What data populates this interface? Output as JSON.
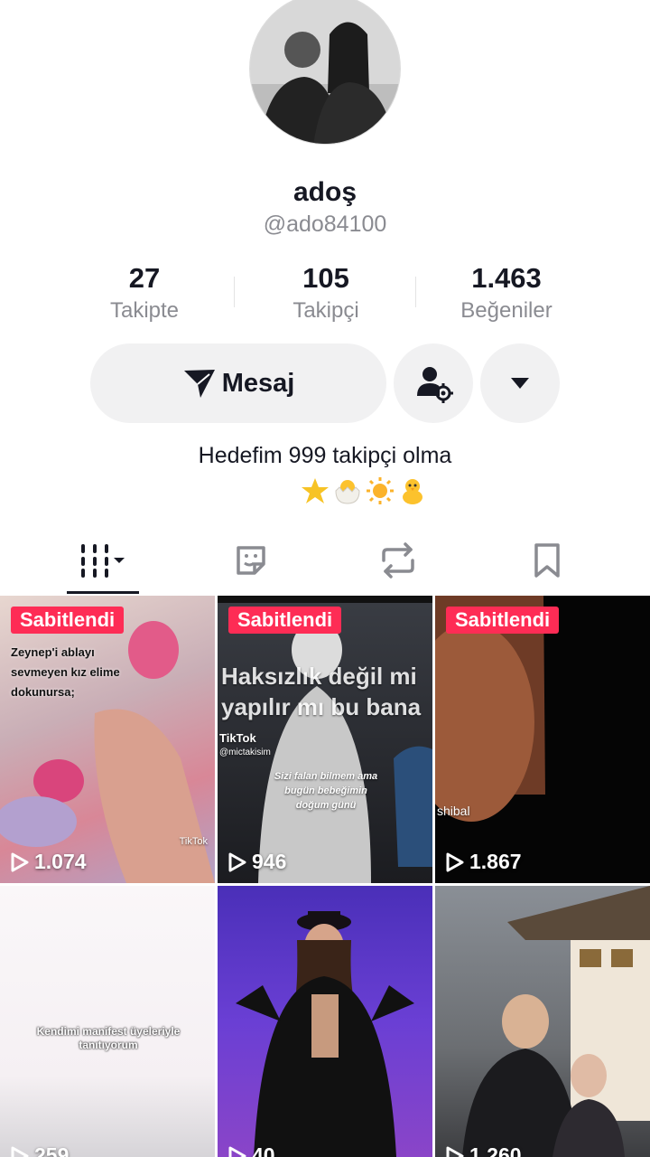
{
  "profile": {
    "display_name": "adoş",
    "username": "@ado84100",
    "bio": "Hedefim 999 takipçi olma",
    "bio_emojis": [
      "star-emoji",
      "hatching-chick-emoji",
      "sun-emoji",
      "baby-chick-emoji"
    ]
  },
  "stats": [
    {
      "value": "27",
      "label": "Takipte"
    },
    {
      "value": "105",
      "label": "Takipçi"
    },
    {
      "value": "1.463",
      "label": "Beğeniler"
    }
  ],
  "actions": {
    "message_label": "Mesaj"
  },
  "tabs": [
    {
      "icon": "grid-icon",
      "active": true
    },
    {
      "icon": "sticker-icon",
      "active": false
    },
    {
      "icon": "repost-icon",
      "active": false
    },
    {
      "icon": "bookmark-icon",
      "active": false
    }
  ],
  "videos": [
    {
      "pinned_label": "Sabitlendi",
      "views": "1.074",
      "caption": "Zeynep'i ablayı sevmeyen kız elime dokunursa;",
      "watermark": "TikTok"
    },
    {
      "pinned_label": "Sabitlendi",
      "views": "946",
      "caption": "Haksızlık değil mi yapılır mı bu bana",
      "subcaption": "Sizi falan bilmem ama bugün bebeğimin doğum günü",
      "watermark_handle": "@mictakisim",
      "watermark": "TikTok"
    },
    {
      "pinned_label": "Sabitlendi",
      "views": "1.867",
      "caption": "shibal"
    },
    {
      "views": "259",
      "caption": "Kendimi manifest üyeleriyle tanıtıyorum"
    },
    {
      "views": "40"
    },
    {
      "views": "1.260"
    }
  ],
  "colors": {
    "accent": "#fe2c55",
    "text_primary": "#161823",
    "text_secondary": "#8a8b91",
    "button_bg": "#f1f1f2"
  }
}
